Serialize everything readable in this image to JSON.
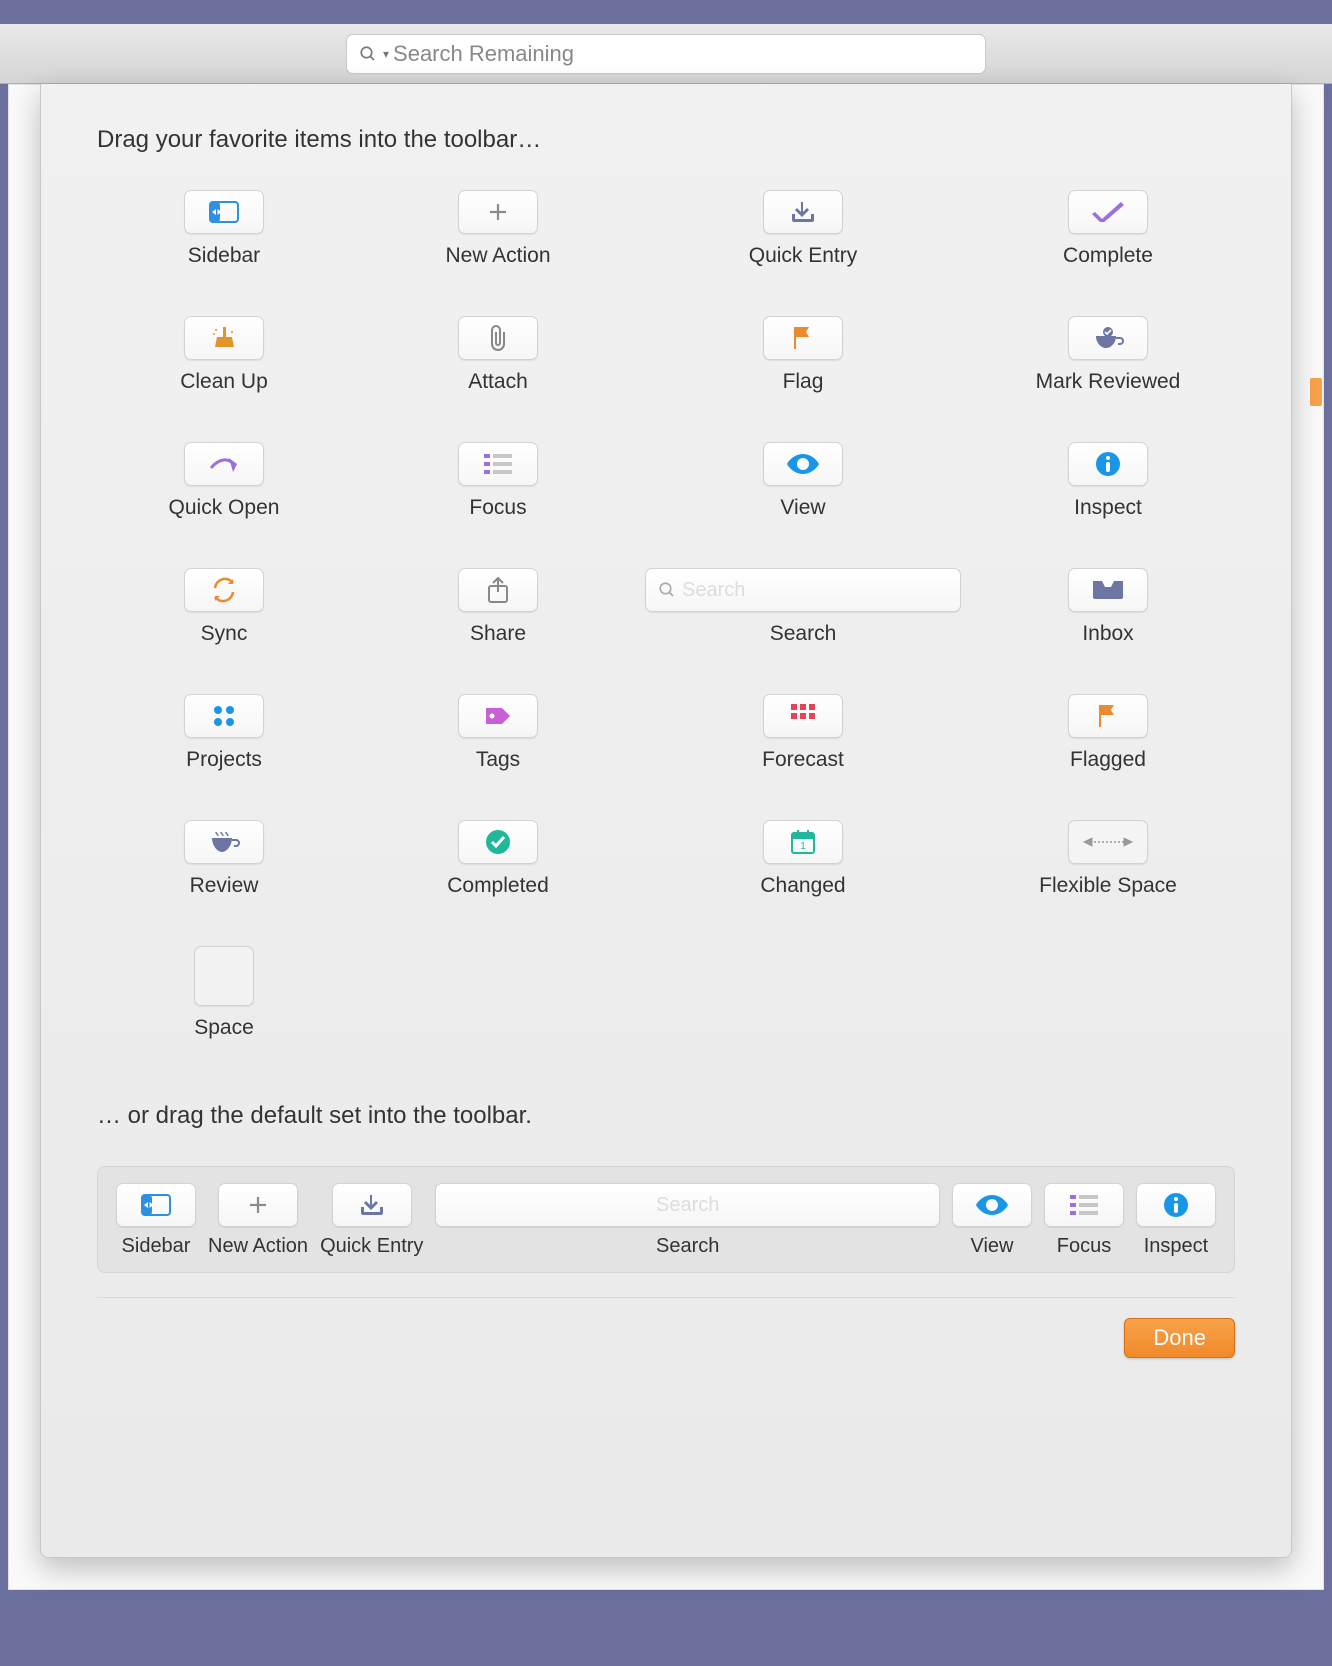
{
  "topbar": {
    "search_placeholder": "Search Remaining"
  },
  "sheet": {
    "heading": "Drag your favorite items into the toolbar…",
    "default_heading": "… or drag the default set into the toolbar.",
    "done_label": "Done",
    "search_placeholder": "Search"
  },
  "items": {
    "sidebar": "Sidebar",
    "new_action": "New Action",
    "quick_entry": "Quick Entry",
    "complete": "Complete",
    "clean_up": "Clean Up",
    "attach": "Attach",
    "flag": "Flag",
    "mark_reviewed": "Mark Reviewed",
    "quick_open": "Quick Open",
    "focus": "Focus",
    "view": "View",
    "inspect": "Inspect",
    "sync": "Sync",
    "share": "Share",
    "search": "Search",
    "inbox": "Inbox",
    "projects": "Projects",
    "tags": "Tags",
    "forecast": "Forecast",
    "flagged": "Flagged",
    "review": "Review",
    "completed": "Completed",
    "changed": "Changed",
    "flexible_space": "Flexible Space",
    "space": "Space"
  },
  "default_set": [
    "Sidebar",
    "New Action",
    "Quick Entry",
    "Search",
    "View",
    "Focus",
    "Inspect"
  ]
}
